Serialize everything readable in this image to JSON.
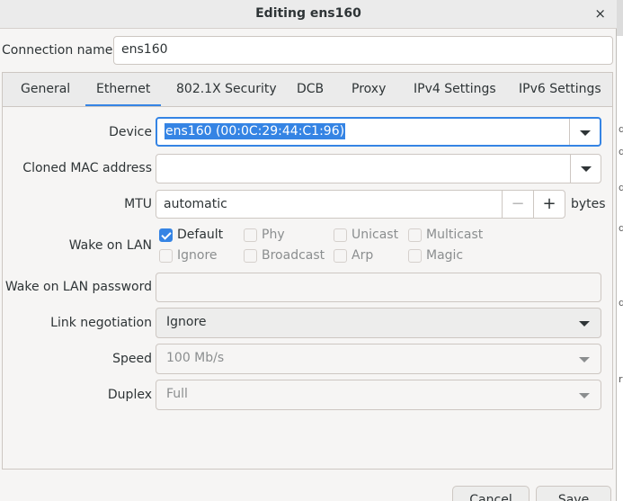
{
  "window": {
    "title": "Editing ens160",
    "close_glyph": "×"
  },
  "connection": {
    "label": "Connection name",
    "value": "ens160"
  },
  "tabs": [
    {
      "label": "General",
      "active": false
    },
    {
      "label": "Ethernet",
      "active": true
    },
    {
      "label": "802.1X Security",
      "active": false
    },
    {
      "label": "DCB",
      "active": false
    },
    {
      "label": "Proxy",
      "active": false
    },
    {
      "label": "IPv4 Settings",
      "active": false
    },
    {
      "label": "IPv6 Settings",
      "active": false
    }
  ],
  "ethernet": {
    "device": {
      "label": "Device",
      "value": "ens160 (00:0C:29:44:C1:96)"
    },
    "cloned_mac": {
      "label": "Cloned MAC address",
      "value": ""
    },
    "mtu": {
      "label": "MTU",
      "value": "automatic",
      "minus": "−",
      "plus": "+",
      "unit": "bytes"
    },
    "wol": {
      "label": "Wake on LAN",
      "options": [
        {
          "label": "Default",
          "checked": true,
          "disabled": false
        },
        {
          "label": "Phy",
          "checked": false,
          "disabled": true
        },
        {
          "label": "Unicast",
          "checked": false,
          "disabled": true
        },
        {
          "label": "Multicast",
          "checked": false,
          "disabled": true
        },
        {
          "label": "Ignore",
          "checked": false,
          "disabled": true
        },
        {
          "label": "Broadcast",
          "checked": false,
          "disabled": true
        },
        {
          "label": "Arp",
          "checked": false,
          "disabled": true
        },
        {
          "label": "Magic",
          "checked": false,
          "disabled": true
        }
      ]
    },
    "wol_password": {
      "label": "Wake on LAN password",
      "value": ""
    },
    "link_negotiation": {
      "label": "Link negotiation",
      "value": "Ignore"
    },
    "speed": {
      "label": "Speed",
      "value": "100 Mb/s"
    },
    "duplex": {
      "label": "Duplex",
      "value": "Full"
    }
  },
  "buttons": {
    "cancel": "Cancel",
    "save": "Save"
  },
  "colors": {
    "accent": "#3584e4",
    "dialog_bg": "#f6f5f4",
    "text": "#2e3436"
  },
  "background_window": {
    "letters": [
      "d",
      "d",
      "d",
      "d",
      "d",
      "r"
    ]
  }
}
